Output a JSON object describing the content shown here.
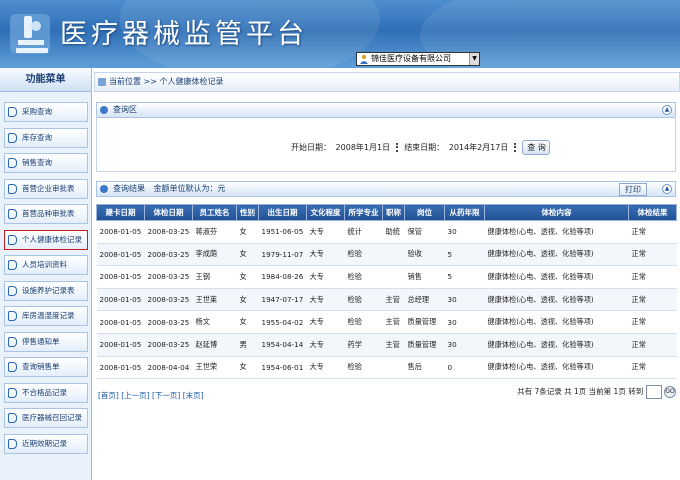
{
  "header": {
    "title": "医疗器械监管平台",
    "company_select": "锦佳医疗设备有限公司"
  },
  "sidebar": {
    "title": "功能菜单",
    "items": [
      {
        "label": "采购查询"
      },
      {
        "label": "库存查询"
      },
      {
        "label": "销售查询"
      },
      {
        "label": "首营企业审批表"
      },
      {
        "label": "首营品种审批表"
      },
      {
        "label": "个人健康体检记录"
      },
      {
        "label": "人员培训资料"
      },
      {
        "label": "设施养护记录表"
      },
      {
        "label": "库房温湿度记录"
      },
      {
        "label": "停售通知单"
      },
      {
        "label": "查询销售单"
      },
      {
        "label": "不合格品记录"
      },
      {
        "label": "医疗器械召回记录"
      },
      {
        "label": "近期效期记录"
      }
    ],
    "active_index": 5
  },
  "breadcrumb": "当前位置 >> 个人健康体检记录",
  "query": {
    "title": "查询区",
    "start_label": "开始日期：",
    "start_value": "2008年1月1日",
    "end_label": "结束日期：",
    "end_value": "2014年2月17日",
    "button": "查 询"
  },
  "results": {
    "title": "查询结果",
    "note": "金额单位默认为：元",
    "print_label": "打印",
    "columns": [
      "建卡日期",
      "体检日期",
      "员工姓名",
      "性别",
      "出生日期",
      "文化程度",
      "所学专业",
      "职称",
      "岗位",
      "从药年限",
      "体检内容",
      "体检结果"
    ],
    "rows": [
      [
        "2008-01-05",
        "2008-03-25",
        "蒋淑芬",
        "女",
        "1951-06-05",
        "大专",
        "统计",
        "助统",
        "保管",
        "30",
        "健康体检(心电、透视、化验等项)",
        "正常"
      ],
      [
        "2008-01-05",
        "2008-03-25",
        "李成荫",
        "女",
        "1979-11-07",
        "大专",
        "检验",
        "",
        "验收",
        "5",
        "健康体检(心电、透视、化验等项)",
        "正常"
      ],
      [
        "2008-01-05",
        "2008-03-25",
        "王钢",
        "女",
        "1984-08-26",
        "大专",
        "检验",
        "",
        "销售",
        "5",
        "健康体检(心电、透视、化验等项)",
        "正常"
      ],
      [
        "2008-01-05",
        "2008-03-25",
        "王世莱",
        "女",
        "1947-07-17",
        "大专",
        "检验",
        "主管",
        "总经理",
        "30",
        "健康体检(心电、透视、化验等项)",
        "正常"
      ],
      [
        "2008-01-05",
        "2008-03-25",
        "杨文",
        "女",
        "1955-04-02",
        "大专",
        "检验",
        "主管",
        "质量管理",
        "30",
        "健康体检(心电、透视、化验等项)",
        "正常"
      ],
      [
        "2008-01-05",
        "2008-03-25",
        "赵延博",
        "男",
        "1954-04-14",
        "大专",
        "药学",
        "主管",
        "质量管理",
        "30",
        "健康体检(心电、透视、化验等项)",
        "正常"
      ],
      [
        "2008-01-05",
        "2008-04-04",
        "王世荣",
        "女",
        "1954-06-01",
        "大专",
        "检验",
        "",
        "售后",
        "0",
        "健康体检(心电、透视、化验等项)",
        "正常"
      ]
    ]
  },
  "pager": {
    "links": [
      "[首页]",
      "[上一页]",
      "[下一页]",
      "[末页]"
    ],
    "summary": "共有 7条记录 共 1页 当前第 1页 转到",
    "go_label": "GO"
  },
  "colors": {
    "header_bg": "#2f6fb6",
    "table_header": "#2a5aa0",
    "accent": "#1a3e72",
    "active_border": "#c62020"
  }
}
